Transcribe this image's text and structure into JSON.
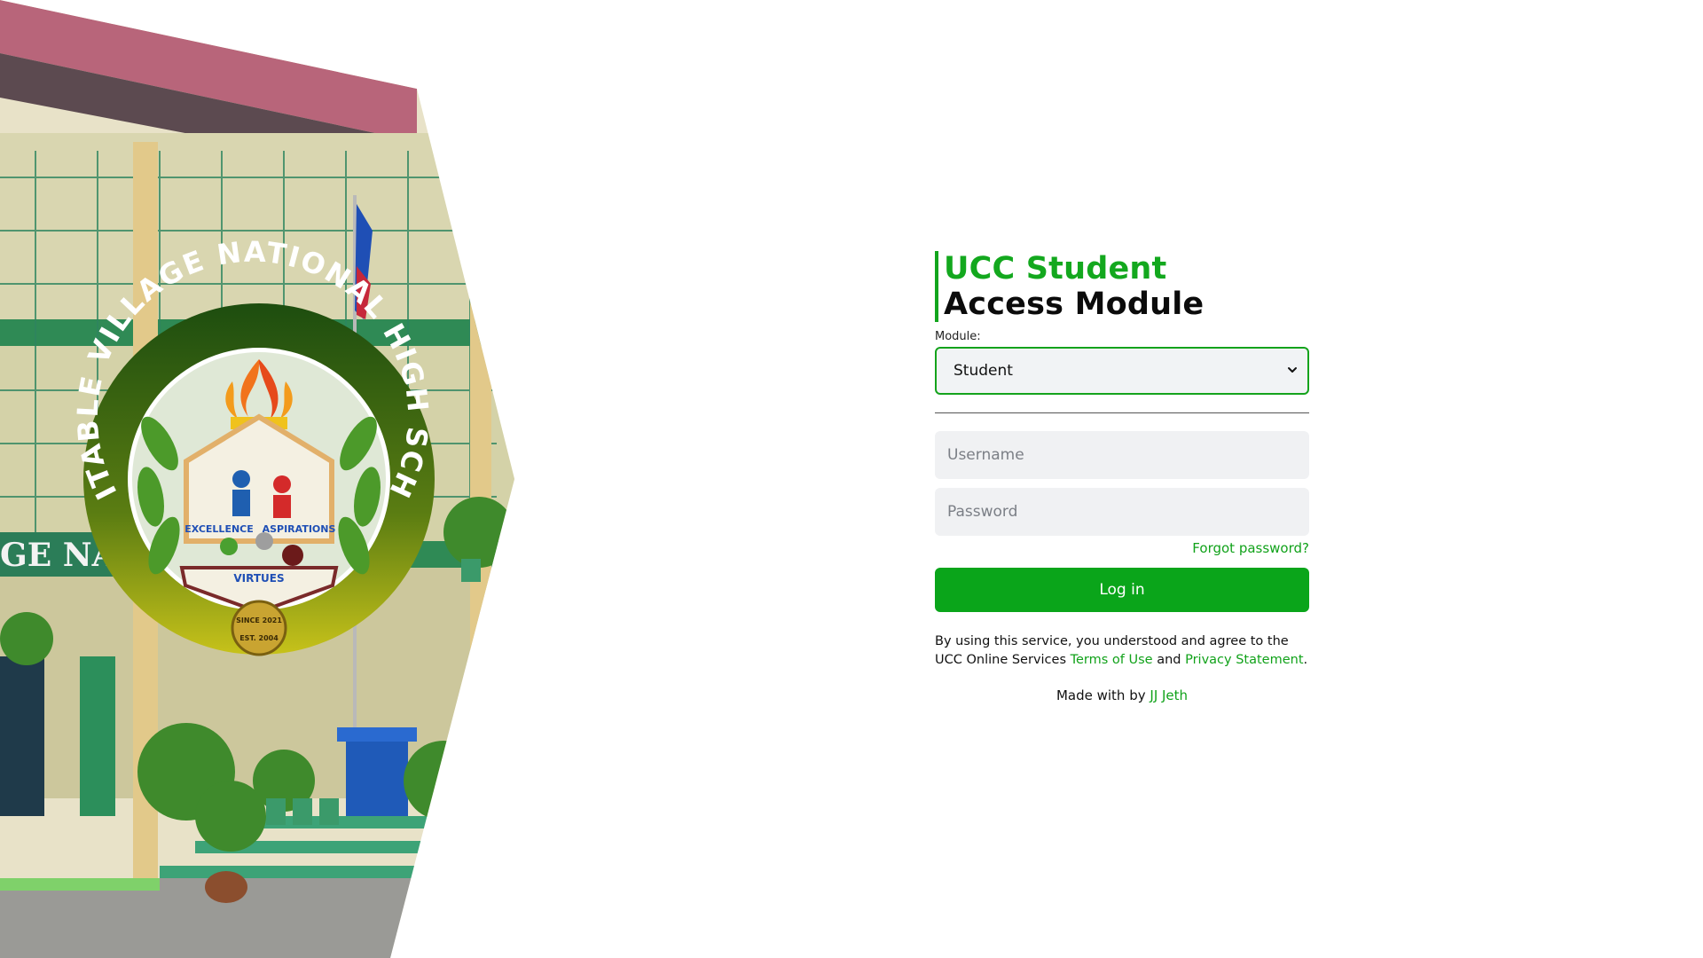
{
  "hero": {
    "seal_top_text": "EQUITABLE VILLAGE NATIONAL HIGH SCHOOL",
    "seal_motto_left": "EXCELLENCE",
    "seal_motto_right": "ASPIRATIONS",
    "seal_motto_bottom": "VIRTUES",
    "seal_medallion_top": "SINCE 2021",
    "seal_medallion_bottom": "EST. 2004",
    "building_sign": "GE NATIONAL"
  },
  "title": {
    "line1": "UCC Student",
    "line2": "Access Module"
  },
  "module": {
    "label": "Module:",
    "selected": "Student"
  },
  "username": {
    "placeholder": "Username"
  },
  "password": {
    "placeholder": "Password"
  },
  "forgot_label": "Forgot password?",
  "login_label": "Log in",
  "terms": {
    "prefix": "By using this service, you understood and agree to the UCC Online Services",
    "terms_link": "Terms of Use",
    "and": "and",
    "privacy_link": "Privacy Statement",
    "suffix": "."
  },
  "footer": {
    "made_with": "Made with by",
    "author": "JJ Jeth"
  },
  "colors": {
    "brand_green": "#0aa51a",
    "title_black": "#0b0b0b",
    "input_bg": "#f0f1f3"
  }
}
